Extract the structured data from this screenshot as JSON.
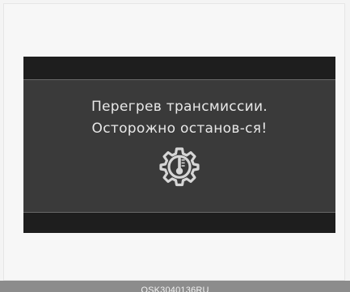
{
  "display": {
    "message_line_1": "Перегрев трансмиссии.",
    "message_line_2": "Осторожно останов-ся!",
    "icon": "transmission-temperature-gear-icon",
    "colors": {
      "background": "#3a3a3a",
      "bars": "#1e1e1e",
      "text": "#e8e8e8",
      "icon": "#d6d6d6"
    }
  },
  "caption": {
    "code": "OSK3040136RU"
  }
}
